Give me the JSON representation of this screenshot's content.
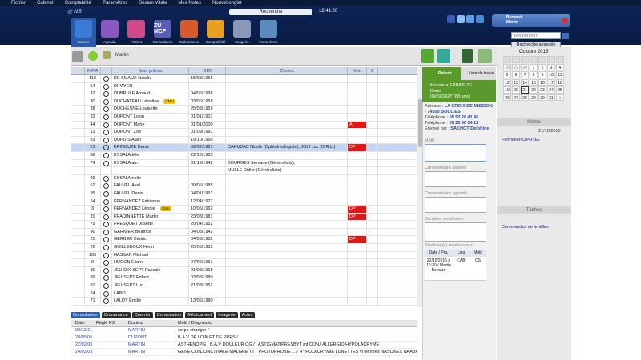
{
  "menu": [
    "Fichier",
    "Cabinet",
    "Comptabilité",
    "Paramètres",
    "Sésam Vitale",
    "Mes Notes",
    "Nouvel onglet"
  ],
  "search_label": "Recherche",
  "time": "12:41:20",
  "logo": "NS",
  "modules": [
    {
      "label": "Bureau",
      "icon_text": "",
      "color": "#3b7bd6",
      "active": true
    },
    {
      "label": "Agenda",
      "icon_text": "",
      "color": "#8a58c0"
    },
    {
      "label": "Patient",
      "icon_text": "",
      "color": "#d04a8a"
    },
    {
      "label": "Consultation",
      "icon_text": "ZU\nMCF",
      "color": "#5a5ab8"
    },
    {
      "label": "Ordonnance",
      "icon_text": "",
      "color": "#d85a2a"
    },
    {
      "label": "Comptabilité",
      "icon_text": "",
      "color": "#e8a020"
    },
    {
      "label": "Imagerie",
      "icon_text": "",
      "color": "#8a98b8"
    },
    {
      "label": "Paramètres",
      "icon_text": "",
      "color": "#5a8abf"
    }
  ],
  "user": {
    "first": "Bernard",
    "last": "Martin"
  },
  "rech_placeholder": "Rechercher",
  "rech_adv": "Recherche avancée",
  "current_patient": "Martin",
  "table_headers": [
    "",
    "INF'A",
    "",
    "Nom prénom",
    "DDN",
    "Corres.",
    "Mot.",
    "€"
  ],
  "rows": [
    [
      "118",
      "",
      "",
      "DE SMAUX Natalie",
      "15/08/1955",
      "",
      "",
      ""
    ],
    [
      "54",
      "",
      "",
      "DIPAYEN",
      "",
      "",
      "",
      ""
    ],
    [
      "32",
      "",
      "",
      "DUBRULE Arnaud",
      "04/05/1996",
      "",
      "",
      ""
    ],
    [
      "30",
      "",
      "",
      "DUCHATEAU Léontine",
      "03/05/1958",
      "CMU",
      "",
      ""
    ],
    [
      "38",
      "",
      "",
      "DUCHESNE Louisette",
      "25/08/1959",
      "",
      "",
      ""
    ],
    [
      "33",
      "",
      "",
      "DUPONT Lolou",
      "01/01/1901",
      "",
      "",
      ""
    ],
    [
      "44",
      "",
      "",
      "DUPONT Marie",
      "01/01/2000",
      "",
      "A",
      ""
    ],
    [
      "13",
      "",
      "",
      "DUPONT Zoé",
      "01/09/1991",
      "",
      "",
      ""
    ],
    [
      "83",
      "",
      "",
      "DUPUIS Alain",
      "19/10/1960",
      "",
      "",
      ""
    ],
    [
      "21",
      "",
      "",
      "EPINOUZE Denis",
      "09/02/1927",
      "CAHUZAC Nicole (Ophtalmologiste), JOLI Luc (O.R.L.)",
      "DP",
      ""
    ],
    [
      "88",
      "",
      "",
      "ESSAI Adèle",
      "22/10/1983",
      "",
      "",
      ""
    ],
    [
      "74",
      "",
      "",
      "ESSAI Alain",
      "01/19/1942",
      "BOURGES Servane (Généraliste),",
      "",
      ""
    ],
    [
      "",
      "",
      "",
      "",
      "",
      "MULLE Didier (Généraliste)",
      "",
      ""
    ],
    [
      "99",
      "",
      "",
      "ESSAI Amelie",
      "",
      "",
      "",
      ""
    ],
    [
      "62",
      "",
      "",
      "FAUVEL Axel",
      "09/05/1985",
      "",
      "",
      ""
    ],
    [
      "95",
      "",
      "",
      "FAUVEL Denis",
      "04/01/1951",
      "",
      "",
      ""
    ],
    [
      "24",
      "",
      "",
      "FERNANDEZ Fabienne",
      "12/04/1977",
      "",
      "",
      ""
    ],
    [
      "3",
      "",
      "",
      "FERNANDEZ Léonie",
      "10/05/1962",
      "CMU",
      "DP",
      ""
    ],
    [
      "20",
      "",
      "",
      "FRADINNETTE Martin",
      "23/08/1981",
      "",
      "DP",
      ""
    ],
    [
      "79",
      "",
      "",
      "FRESQUET Josette",
      "20/04/1952",
      "",
      "",
      ""
    ],
    [
      "90",
      "",
      "",
      "GARNIER Béatrice",
      "04/08/1942",
      "",
      "",
      ""
    ],
    [
      "25",
      "",
      "",
      "GERBER Cédric",
      "04/03/1982",
      "",
      "DP",
      ""
    ],
    [
      "26",
      "",
      "",
      "GUILLEDOUX Henri",
      "25/03/1933",
      "",
      "",
      ""
    ],
    [
      "105",
      "",
      "",
      "HASSAN Michael",
      "",
      "",
      "",
      ""
    ],
    [
      "9",
      "",
      "",
      "HUGON Eliane",
      "27/02/1951",
      "",
      "",
      ""
    ],
    [
      "80",
      "",
      "",
      "JEU-DIX-SEPT Pascale",
      "01/08/1968",
      "",
      "",
      ""
    ],
    [
      "89",
      "",
      "",
      "JEU-SEPT Enfant",
      "03/08/1980",
      "",
      "",
      ""
    ],
    [
      "91",
      "",
      "",
      "JEU-SEPT Luc",
      "21/08/1952",
      "",
      "",
      ""
    ],
    [
      "24",
      "",
      "",
      "LABO",
      "",
      "",
      "",
      ""
    ],
    [
      "71",
      "",
      "",
      "LALOY Emilie",
      "13/06/1980",
      "",
      "",
      ""
    ]
  ],
  "bottom_tabs": [
    "Consultation",
    "Ordonnance",
    "Courrier",
    "Convocation",
    "Médicament",
    "Imagerie",
    "Actes"
  ],
  "hist_headers": [
    "Date",
    "Réglé FS",
    "Docteur",
    "Motif / Diagnostic"
  ],
  "hist_rows": [
    [
      "08/12/11",
      "",
      "MARTIN",
      "corps etranger /"
    ],
    [
      "28/09/06",
      "",
      "DUPONT",
      "B.A.V DE LOIN ET DE PRES /"
    ],
    [
      "22/02/06",
      "",
      "MARTIN",
      "ASTHENOPIE : B.A.V DOULEUR OG / : ASTIGMATIPRESBYT mf CONJ ALLERGIQ HYPOLACRYME"
    ],
    [
      "24/03/03",
      "",
      "MARTIN",
      "GENE CONJONCTIVALE MALGRE TTT  PHOTOPHOBIE ... / HYPOLACRYMIE LUNETTES vl teintees NASONEX NAABAK"
    ]
  ],
  "patient_panel": {
    "tab": "Patient",
    "tab2": "Liste de travail",
    "title": "Monsieur EPINOUZE",
    "name": "Denis",
    "dob": "09/02/1927 (88 ans)",
    "addr_label": "Adresse :",
    "addr1": "LA CROIX DE MISSION",
    "addr2": "- 74550 BOULIES",
    "tel1_label": "Téléphone :",
    "tel1": "05 53 28 41 40",
    "tel2_label": "Téléphone :",
    "tel2": "06 26 98 54 12",
    "env_label": "Envoyé par :",
    "env": "SACHOT Delphine",
    "motif": "Motif :",
    "comment_patient": "Commentaire patient",
    "comment_agenda": "Commentaire agenda",
    "last_concl": "Dernière conclusion",
    "next_rdv": "Prochain(s) rendez-vous",
    "rdv_headers": [
      "Date / Pra.",
      "Lieu",
      "Motif"
    ],
    "rdv": [
      "22/10/2015 à 16:30 / Martin Bernard",
      "CAB",
      "CS"
    ]
  },
  "calendar": {
    "title": "Octobre 2015",
    "days": [
      "",
      "",
      "",
      "",
      "",
      "",
      ""
    ],
    "cells": [
      "28",
      "29",
      "30",
      "1",
      "2",
      "3",
      "4",
      "5",
      "6",
      "7",
      "8",
      "9",
      "10",
      "11",
      "12",
      "13",
      "14",
      "15",
      "16",
      "17",
      "18",
      "19",
      "20",
      "21",
      "22",
      "23",
      "24",
      "25",
      "26",
      "27",
      "28",
      "29",
      "30",
      "31",
      "1"
    ]
  },
  "memo": {
    "title": "Mémo",
    "date": "21/10/2015",
    "item": "Formation OPHTEL"
  },
  "taches": {
    "title": "Tâches",
    "item": "Commandes de lentilles"
  }
}
